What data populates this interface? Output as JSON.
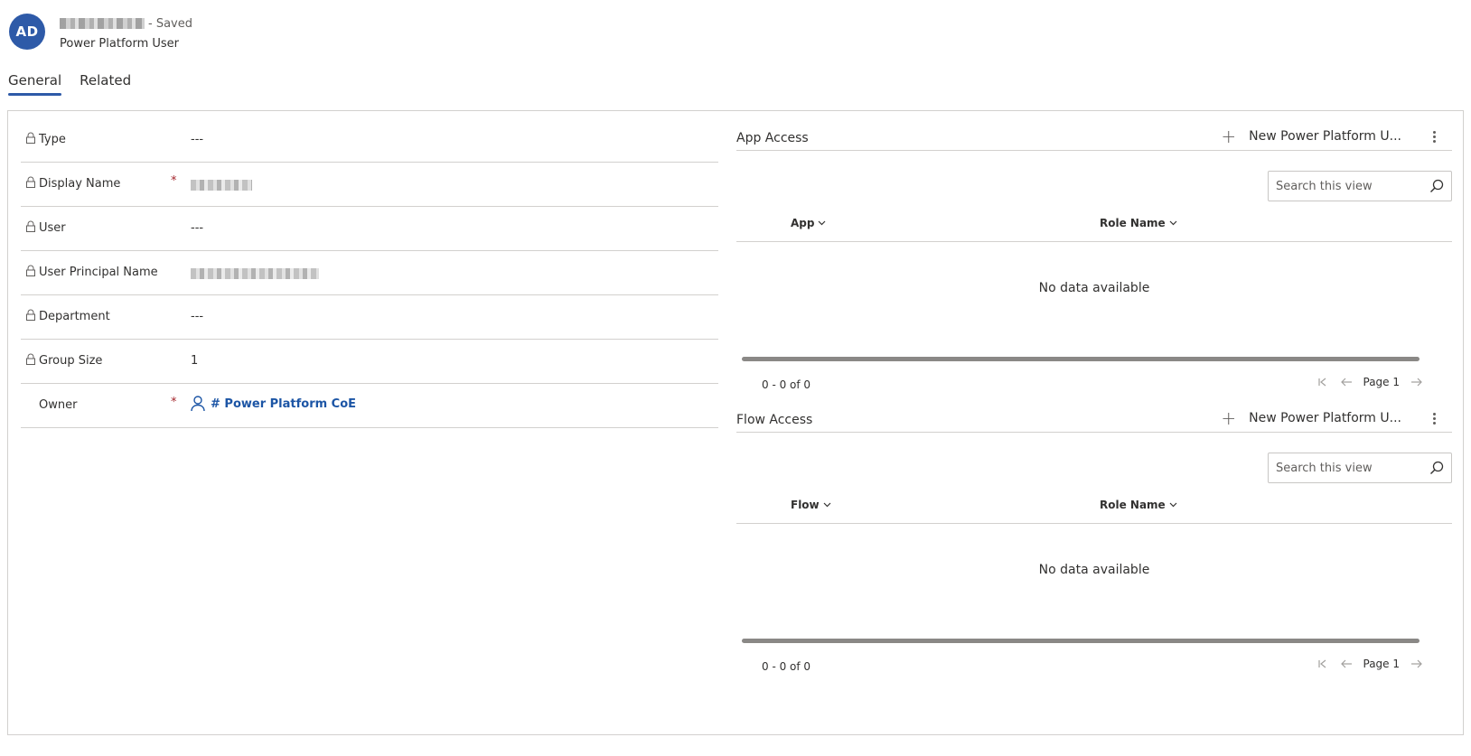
{
  "header": {
    "avatar_initials": "AD",
    "status": "- Saved",
    "entity_type": "Power Platform User"
  },
  "tabs": [
    {
      "label": "General",
      "active": true
    },
    {
      "label": "Related",
      "active": false
    }
  ],
  "form": {
    "fields": [
      {
        "label": "Type",
        "value": "---"
      },
      {
        "label": "Display Name",
        "value": ""
      },
      {
        "label": "User",
        "value": "---"
      },
      {
        "label": "User Principal Name",
        "value": ""
      },
      {
        "label": "Department",
        "value": "---"
      },
      {
        "label": "Group Size",
        "value": "1"
      },
      {
        "label": "Owner",
        "value": "# Power Platform CoE"
      }
    ],
    "required_mark": "*"
  },
  "app_access": {
    "title": "App Access",
    "new_button_label": "New Power Platform U...",
    "search_placeholder": "Search this view",
    "columns": [
      "App",
      "Role Name"
    ],
    "empty_message": "No data available",
    "record_count": "0 - 0 of 0",
    "page_label": "Page 1"
  },
  "flow_access": {
    "title": "Flow Access",
    "new_button_label": "New Power Platform U...",
    "search_placeholder": "Search this view",
    "columns": [
      "Flow",
      "Role Name"
    ],
    "empty_message": "No data available",
    "record_count": "0 - 0 of 0",
    "page_label": "Page 1"
  },
  "colors": {
    "accent": "#2e5aa8",
    "link": "#1c55a5",
    "required": "#a4262c",
    "border": "#d2d0ce"
  },
  "icons": [
    "lock-icon",
    "person-icon",
    "plus-icon",
    "more-icon",
    "search-icon",
    "chevron-down-icon",
    "first-page-icon",
    "previous-page-icon",
    "next-page-icon"
  ]
}
